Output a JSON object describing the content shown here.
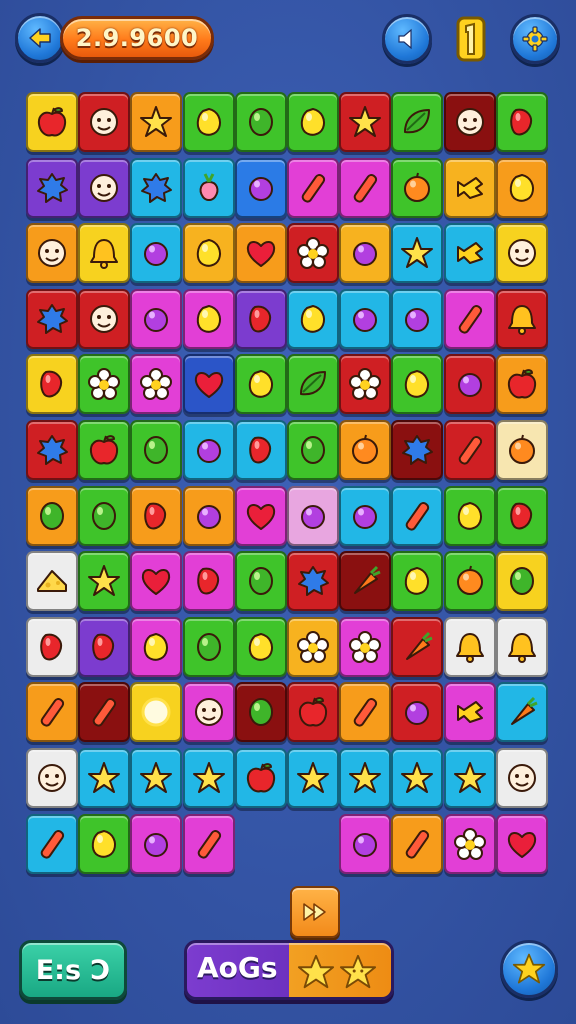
{
  "hud": {
    "score": "2.9.9600",
    "back_icon": "arrow-left-icon",
    "sound_icon": "speaker-icon",
    "coin_icon": "coin-icon",
    "settings_icon": "gear-icon"
  },
  "colors": {
    "background": "#3555a8",
    "accent_orange": "#ff7a1a",
    "accent_blue": "#1f77d8",
    "accent_purple": "#7c3ccf",
    "accent_teal": "#19a883"
  },
  "board": {
    "rows": 12,
    "cols": 10,
    "tiles": [
      {
        "row": 0,
        "col": 0,
        "color": "#f7d21f",
        "icon": "apple"
      },
      {
        "row": 0,
        "col": 1,
        "color": "#cf1f23",
        "icon": "face"
      },
      {
        "row": 0,
        "col": 2,
        "color": "#f79c1b",
        "icon": "star"
      },
      {
        "row": 0,
        "col": 3,
        "color": "#3fc42a",
        "icon": "lemon"
      },
      {
        "row": 0,
        "col": 4,
        "color": "#3fc42a",
        "icon": "lime"
      },
      {
        "row": 0,
        "col": 5,
        "color": "#3fc42a",
        "icon": "lemon"
      },
      {
        "row": 0,
        "col": 6,
        "color": "#cf1f23",
        "icon": "star"
      },
      {
        "row": 0,
        "col": 7,
        "color": "#3fc42a",
        "icon": "leaf"
      },
      {
        "row": 0,
        "col": 8,
        "color": "#8a1010",
        "icon": "face"
      },
      {
        "row": 0,
        "col": 9,
        "color": "#3fc42a",
        "icon": "pepper"
      },
      {
        "row": 1,
        "col": 0,
        "color": "#7c3ccf",
        "icon": "splat"
      },
      {
        "row": 1,
        "col": 1,
        "color": "#7c3ccf",
        "icon": "face"
      },
      {
        "row": 1,
        "col": 2,
        "color": "#22b7e6",
        "icon": "splat"
      },
      {
        "row": 1,
        "col": 3,
        "color": "#22b7e6",
        "icon": "radish"
      },
      {
        "row": 1,
        "col": 4,
        "color": "#2b7be6",
        "icon": "grape"
      },
      {
        "row": 1,
        "col": 5,
        "color": "#e23fd6",
        "icon": "candy-stick"
      },
      {
        "row": 1,
        "col": 6,
        "color": "#e23fd6",
        "icon": "candy-stick"
      },
      {
        "row": 1,
        "col": 7,
        "color": "#3fc42a",
        "icon": "orange"
      },
      {
        "row": 1,
        "col": 8,
        "color": "#f7b21f",
        "icon": "candy-wrapped"
      },
      {
        "row": 1,
        "col": 9,
        "color": "#f79c1b",
        "icon": "lemon"
      },
      {
        "row": 2,
        "col": 0,
        "color": "#f79c1b",
        "icon": "face"
      },
      {
        "row": 2,
        "col": 1,
        "color": "#f7d21f",
        "icon": "bell"
      },
      {
        "row": 2,
        "col": 2,
        "color": "#22b7e6",
        "icon": "grape"
      },
      {
        "row": 2,
        "col": 3,
        "color": "#f7b21f",
        "icon": "lemon"
      },
      {
        "row": 2,
        "col": 4,
        "color": "#f79c1b",
        "icon": "heart"
      },
      {
        "row": 2,
        "col": 5,
        "color": "#cf1f23",
        "icon": "flower"
      },
      {
        "row": 2,
        "col": 6,
        "color": "#f7b21f",
        "icon": "grape"
      },
      {
        "row": 2,
        "col": 7,
        "color": "#22b7e6",
        "icon": "star"
      },
      {
        "row": 2,
        "col": 8,
        "color": "#22b7e6",
        "icon": "candy-wrapped"
      },
      {
        "row": 2,
        "col": 9,
        "color": "#f7d21f",
        "icon": "face"
      },
      {
        "row": 3,
        "col": 0,
        "color": "#cf1f23",
        "icon": "splat"
      },
      {
        "row": 3,
        "col": 1,
        "color": "#cf1f23",
        "icon": "face"
      },
      {
        "row": 3,
        "col": 2,
        "color": "#e23fd6",
        "icon": "grape"
      },
      {
        "row": 3,
        "col": 3,
        "color": "#e23fd6",
        "icon": "lemon"
      },
      {
        "row": 3,
        "col": 4,
        "color": "#7c3ccf",
        "icon": "pepper"
      },
      {
        "row": 3,
        "col": 5,
        "color": "#22b7e6",
        "icon": "lemon"
      },
      {
        "row": 3,
        "col": 6,
        "color": "#22b7e6",
        "icon": "grape"
      },
      {
        "row": 3,
        "col": 7,
        "color": "#22b7e6",
        "icon": "grape"
      },
      {
        "row": 3,
        "col": 8,
        "color": "#e23fd6",
        "icon": "candy-stick"
      },
      {
        "row": 3,
        "col": 9,
        "color": "#cf1f23",
        "icon": "bell"
      },
      {
        "row": 4,
        "col": 0,
        "color": "#f7d21f",
        "icon": "pepper"
      },
      {
        "row": 4,
        "col": 1,
        "color": "#3fc42a",
        "icon": "flower"
      },
      {
        "row": 4,
        "col": 2,
        "color": "#e23fd6",
        "icon": "flower"
      },
      {
        "row": 4,
        "col": 3,
        "color": "#2b55c8",
        "icon": "heart"
      },
      {
        "row": 4,
        "col": 4,
        "color": "#3fc42a",
        "icon": "lemon"
      },
      {
        "row": 4,
        "col": 5,
        "color": "#3fc42a",
        "icon": "leaf"
      },
      {
        "row": 4,
        "col": 6,
        "color": "#cf1f23",
        "icon": "flower"
      },
      {
        "row": 4,
        "col": 7,
        "color": "#3fc42a",
        "icon": "lemon"
      },
      {
        "row": 4,
        "col": 8,
        "color": "#cf1f23",
        "icon": "grape"
      },
      {
        "row": 4,
        "col": 9,
        "color": "#f79c1b",
        "icon": "apple"
      },
      {
        "row": 5,
        "col": 0,
        "color": "#cf1f23",
        "icon": "splat"
      },
      {
        "row": 5,
        "col": 1,
        "color": "#3fc42a",
        "icon": "apple"
      },
      {
        "row": 5,
        "col": 2,
        "color": "#3fc42a",
        "icon": "lime"
      },
      {
        "row": 5,
        "col": 3,
        "color": "#22b7e6",
        "icon": "grape"
      },
      {
        "row": 5,
        "col": 4,
        "color": "#22b7e6",
        "icon": "pepper"
      },
      {
        "row": 5,
        "col": 5,
        "color": "#3fc42a",
        "icon": "lime"
      },
      {
        "row": 5,
        "col": 6,
        "color": "#f79c1b",
        "icon": "orange"
      },
      {
        "row": 5,
        "col": 7,
        "color": "#8a1010",
        "icon": "splat"
      },
      {
        "row": 5,
        "col": 8,
        "color": "#cf1f23",
        "icon": "candy-stick"
      },
      {
        "row": 5,
        "col": 9,
        "color": "#f7e6b0",
        "icon": "orange"
      },
      {
        "row": 6,
        "col": 0,
        "color": "#f79c1b",
        "icon": "lime"
      },
      {
        "row": 6,
        "col": 1,
        "color": "#3fc42a",
        "icon": "lime"
      },
      {
        "row": 6,
        "col": 2,
        "color": "#f79c1b",
        "icon": "pepper"
      },
      {
        "row": 6,
        "col": 3,
        "color": "#f79c1b",
        "icon": "grape"
      },
      {
        "row": 6,
        "col": 4,
        "color": "#e23fd6",
        "icon": "heart"
      },
      {
        "row": 6,
        "col": 5,
        "color": "#e8a6e0",
        "icon": "grape"
      },
      {
        "row": 6,
        "col": 6,
        "color": "#22b7e6",
        "icon": "grape"
      },
      {
        "row": 6,
        "col": 7,
        "color": "#22b7e6",
        "icon": "candy-stick"
      },
      {
        "row": 6,
        "col": 8,
        "color": "#3fc42a",
        "icon": "lemon"
      },
      {
        "row": 6,
        "col": 9,
        "color": "#3fc42a",
        "icon": "pepper"
      },
      {
        "row": 7,
        "col": 0,
        "color": "#ededed",
        "icon": "cheese"
      },
      {
        "row": 7,
        "col": 1,
        "color": "#3fc42a",
        "icon": "star"
      },
      {
        "row": 7,
        "col": 2,
        "color": "#e23fd6",
        "icon": "heart"
      },
      {
        "row": 7,
        "col": 3,
        "color": "#e23fd6",
        "icon": "pepper"
      },
      {
        "row": 7,
        "col": 4,
        "color": "#3fc42a",
        "icon": "lime"
      },
      {
        "row": 7,
        "col": 5,
        "color": "#cf1f23",
        "icon": "splat"
      },
      {
        "row": 7,
        "col": 6,
        "color": "#8a1010",
        "icon": "carrot"
      },
      {
        "row": 7,
        "col": 7,
        "color": "#3fc42a",
        "icon": "lemon"
      },
      {
        "row": 7,
        "col": 8,
        "color": "#3fc42a",
        "icon": "orange"
      },
      {
        "row": 7,
        "col": 9,
        "color": "#f7d21f",
        "icon": "lime"
      },
      {
        "row": 8,
        "col": 0,
        "color": "#ededed",
        "icon": "pepper"
      },
      {
        "row": 8,
        "col": 1,
        "color": "#7c3ccf",
        "icon": "pepper"
      },
      {
        "row": 8,
        "col": 2,
        "color": "#e23fd6",
        "icon": "lemon"
      },
      {
        "row": 8,
        "col": 3,
        "color": "#3fc42a",
        "icon": "lime"
      },
      {
        "row": 8,
        "col": 4,
        "color": "#3fc42a",
        "icon": "lemon"
      },
      {
        "row": 8,
        "col": 5,
        "color": "#f7b21f",
        "icon": "flower"
      },
      {
        "row": 8,
        "col": 6,
        "color": "#e23fd6",
        "icon": "flower"
      },
      {
        "row": 8,
        "col": 7,
        "color": "#cf1f23",
        "icon": "carrot"
      },
      {
        "row": 8,
        "col": 8,
        "color": "#ededed",
        "icon": "bell"
      },
      {
        "row": 8,
        "col": 9,
        "color": "#ededed",
        "icon": "bell"
      },
      {
        "row": 9,
        "col": 0,
        "color": "#f79c1b",
        "icon": "candy-stick"
      },
      {
        "row": 9,
        "col": 1,
        "color": "#8a1010",
        "icon": "candy-stick"
      },
      {
        "row": 9,
        "col": 2,
        "color": "#f7d21f",
        "icon": "glow"
      },
      {
        "row": 9,
        "col": 3,
        "color": "#e23fd6",
        "icon": "face"
      },
      {
        "row": 9,
        "col": 4,
        "color": "#8a1010",
        "icon": "lime"
      },
      {
        "row": 9,
        "col": 5,
        "color": "#cf1f23",
        "icon": "apple"
      },
      {
        "row": 9,
        "col": 6,
        "color": "#f79c1b",
        "icon": "candy-stick"
      },
      {
        "row": 9,
        "col": 7,
        "color": "#cf1f23",
        "icon": "grape"
      },
      {
        "row": 9,
        "col": 8,
        "color": "#e23fd6",
        "icon": "candy-wrapped"
      },
      {
        "row": 9,
        "col": 9,
        "color": "#22b7e6",
        "icon": "carrot"
      },
      {
        "row": 10,
        "col": 0,
        "color": "#ededed",
        "icon": "face"
      },
      {
        "row": 10,
        "col": 1,
        "color": "#22b7e6",
        "icon": "star"
      },
      {
        "row": 10,
        "col": 2,
        "color": "#22b7e6",
        "icon": "star"
      },
      {
        "row": 10,
        "col": 3,
        "color": "#22b7e6",
        "icon": "star"
      },
      {
        "row": 10,
        "col": 4,
        "color": "#22b7e6",
        "icon": "apple"
      },
      {
        "row": 10,
        "col": 5,
        "color": "#22b7e6",
        "icon": "star"
      },
      {
        "row": 10,
        "col": 6,
        "color": "#22b7e6",
        "icon": "star"
      },
      {
        "row": 10,
        "col": 7,
        "color": "#22b7e6",
        "icon": "star"
      },
      {
        "row": 10,
        "col": 8,
        "color": "#22b7e6",
        "icon": "star"
      },
      {
        "row": 10,
        "col": 9,
        "color": "#ededed",
        "icon": "face"
      },
      {
        "row": 11,
        "col": 0,
        "color": "#22b7e6",
        "icon": "candy-stick"
      },
      {
        "row": 11,
        "col": 1,
        "color": "#3fc42a",
        "icon": "lemon"
      },
      {
        "row": 11,
        "col": 2,
        "color": "#e23fd6",
        "icon": "grape"
      },
      {
        "row": 11,
        "col": 3,
        "color": "#e23fd6",
        "icon": "candy-stick"
      },
      {
        "row": 11,
        "col": 6,
        "color": "#e23fd6",
        "icon": "grape"
      },
      {
        "row": 11,
        "col": 7,
        "color": "#f79c1b",
        "icon": "candy-stick"
      },
      {
        "row": 11,
        "col": 8,
        "color": "#e23fd6",
        "icon": "flower"
      },
      {
        "row": 11,
        "col": 9,
        "color": "#e23fd6",
        "icon": "heart"
      }
    ]
  },
  "controls": {
    "skip_icon": "fast-forward-icon",
    "left_label": "E:s Ɔ",
    "combo_label": "AoGs",
    "combo_icons": [
      "star-icon",
      "star-icon"
    ],
    "star_button_icon": "star-icon"
  }
}
